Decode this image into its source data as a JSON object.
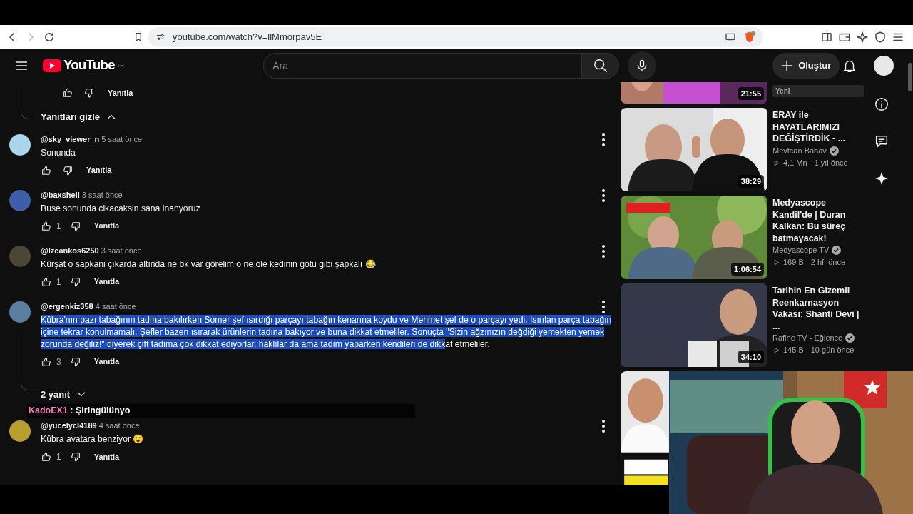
{
  "browser": {
    "url": "youtube.com/watch?v=llMmorpav5E"
  },
  "masthead": {
    "logo": "YouTube",
    "country": "TR",
    "search_placeholder": "Ara",
    "create_label": "Oluştur"
  },
  "comments": {
    "top_reply_label": "Yanıtla",
    "hide_replies": "Yanıtları gizle",
    "items": [
      {
        "author": "@sky_viewer_n",
        "time": "5 saat önce",
        "text": "Sonunda",
        "reply_label": "Yanıtla",
        "color": "#a9d6ec"
      },
      {
        "author": "@baxsheli",
        "time": "3 saat önce",
        "text": "Buse sonunda cikacaksin sana inanyoruz",
        "likes": "1",
        "reply_label": "Yanıtla",
        "color": "#3c5fa8"
      },
      {
        "author": "@Izcankos6250",
        "time": "3 saat önce",
        "text": "Kürşat o sapkani çıkarda altında ne bk var görelim o ne öle kedinin gotu gibi şapkalı 😂",
        "likes": "1",
        "reply_label": "Yanıtla",
        "color": "#4a4536"
      },
      {
        "author": "@ergenkiz358",
        "time": "4 saat önce",
        "text_parts": [
          {
            "text": "Kübra'nın pazı tabağının tadına bakılırken Somer şef ısırdığı parçayı tabağın kenarına koydu ve Mehmet şef de o parçayı yedi. Isırılan parça tabağın içine tekrar konulmamalı. Şefler bazen ısırarak ürünlerin tadına bakıyor ve buna dikkat etmeliler. Sonuçta \"Sizin ağzınızın değdiği yemekten yemek zorunda değiliz!\" diyerek çift tadıma çok dikkat ediyorlar, haklılar da ama tadım yaparken kendileri de dikk",
            "selected": true
          },
          {
            "text": "at etmeliler.",
            "selected": false
          }
        ],
        "likes": "3",
        "reply_label": "Yanıtla",
        "color": "#5a7fa0",
        "replies": "2 yanıt"
      },
      {
        "author": "@yucelycl4189",
        "time": "4 saat önce",
        "text": "Kübra avatara benziyor 😮",
        "likes": "1",
        "reply_label": "Yanıtla",
        "color": "#b8a030"
      }
    ]
  },
  "chat_overlay": {
    "user": "KadoEX1",
    "message": ": Şiringülünyo",
    "color": "#f07ab8"
  },
  "videos": [
    {
      "kind": "partial",
      "badge": "Yeni",
      "duration": "21:55"
    },
    {
      "kind": "video",
      "title": "ERAY ile HAYATLARIMIZI DEĞİŞTİRDİK - ...",
      "channel": "Mevtcan Bahav",
      "verified": true,
      "views": "4,1 Mn",
      "age": "1 yıl önce",
      "duration": "38:29"
    },
    {
      "kind": "video",
      "title": "Medyascope Kandil'de | Duran Kalkan: Bu süreç batmayacak!",
      "channel": "Medyascope TV",
      "verified": true,
      "views": "169 B",
      "age": "2 hf. önce",
      "duration": "1:06:54"
    },
    {
      "kind": "video",
      "title": "Tarihin En Gizemli Reenkarnasyon Vakası: Shanti Devi | ...",
      "channel": "Rafine TV - Eğlence",
      "verified": true,
      "views": "145 B",
      "age": "10 gün önce",
      "duration": "34:10"
    },
    {
      "kind": "picture"
    }
  ]
}
